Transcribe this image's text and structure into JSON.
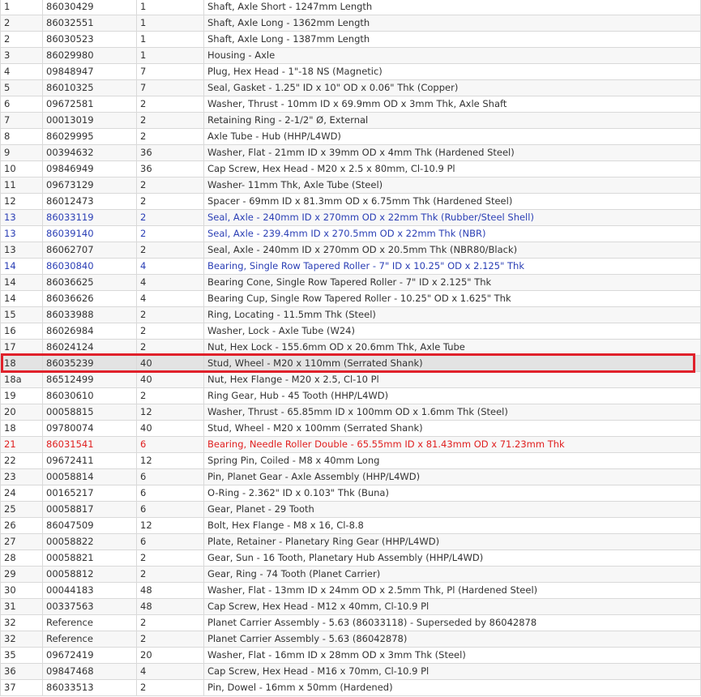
{
  "parts_table": {
    "columns": [
      "ref",
      "part_no",
      "qty",
      "description"
    ],
    "rows": [
      {
        "ref": "1",
        "part_no": "86030429",
        "qty": "1",
        "description": "Shaft, Axle Short - 1247mm Length",
        "style": "normal"
      },
      {
        "ref": "2",
        "part_no": "86032551",
        "qty": "1",
        "description": "Shaft, Axle Long - 1362mm Length",
        "style": "normal"
      },
      {
        "ref": "2",
        "part_no": "86030523",
        "qty": "1",
        "description": "Shaft, Axle Long - 1387mm Length",
        "style": "normal"
      },
      {
        "ref": "3",
        "part_no": "86029980",
        "qty": "1",
        "description": "Housing - Axle",
        "style": "normal"
      },
      {
        "ref": "4",
        "part_no": "09848947",
        "qty": "7",
        "description": "Plug, Hex Head - 1\"-18 NS (Magnetic)",
        "style": "normal"
      },
      {
        "ref": "5",
        "part_no": "86010325",
        "qty": "7",
        "description": "Seal, Gasket - 1.25\" ID x 10\" OD x 0.06\" Thk (Copper)",
        "style": "normal"
      },
      {
        "ref": "6",
        "part_no": "09672581",
        "qty": "2",
        "description": "Washer, Thrust - 10mm ID x 69.9mm OD x 3mm Thk, Axle Shaft",
        "style": "normal"
      },
      {
        "ref": "7",
        "part_no": "00013019",
        "qty": "2",
        "description": "Retaining Ring - 2-1/2\" Ø, External",
        "style": "normal"
      },
      {
        "ref": "8",
        "part_no": "86029995",
        "qty": "2",
        "description": "Axle Tube - Hub (HHP/L4WD)",
        "style": "normal"
      },
      {
        "ref": "9",
        "part_no": "00394632",
        "qty": "36",
        "description": "Washer, Flat - 21mm ID x 39mm OD x 4mm Thk (Hardened Steel)",
        "style": "normal"
      },
      {
        "ref": "10",
        "part_no": "09846949",
        "qty": "36",
        "description": "Cap Screw, Hex Head - M20 x 2.5 x 80mm, Cl-10.9 Pl",
        "style": "normal"
      },
      {
        "ref": "11",
        "part_no": "09673129",
        "qty": "2",
        "description": "Washer- 11mm Thk, Axle Tube (Steel)",
        "style": "normal"
      },
      {
        "ref": "12",
        "part_no": "86012473",
        "qty": "2",
        "description": "Spacer - 69mm ID x 81.3mm OD x 6.75mm Thk (Hardened Steel)",
        "style": "normal"
      },
      {
        "ref": "13",
        "part_no": "86033119",
        "qty": "2",
        "description": "Seal, Axle - 240mm ID x 270mm OD x 22mm Thk (Rubber/Steel Shell)",
        "style": "link"
      },
      {
        "ref": "13",
        "part_no": "86039140",
        "qty": "2",
        "description": "Seal, Axle - 239.4mm ID x 270.5mm OD x 22mm Thk (NBR)",
        "style": "link"
      },
      {
        "ref": "13",
        "part_no": "86062707",
        "qty": "2",
        "description": "Seal, Axle - 240mm ID x 270mm OD x 20.5mm Thk (NBR80/Black)",
        "style": "normal"
      },
      {
        "ref": "14",
        "part_no": "86030840",
        "qty": "4",
        "description": "Bearing, Single Row Tapered Roller - 7\" ID x 10.25\" OD x 2.125\" Thk",
        "style": "link"
      },
      {
        "ref": "14",
        "part_no": "86036625",
        "qty": "4",
        "description": "Bearing Cone, Single Row Tapered Roller - 7\" ID x 2.125\" Thk",
        "style": "normal"
      },
      {
        "ref": "14",
        "part_no": "86036626",
        "qty": "4",
        "description": "Bearing Cup, Single Row Tapered Roller - 10.25\" OD x 1.625\" Thk",
        "style": "normal"
      },
      {
        "ref": "15",
        "part_no": "86033988",
        "qty": "2",
        "description": "Ring, Locating - 11.5mm Thk (Steel)",
        "style": "normal"
      },
      {
        "ref": "16",
        "part_no": "86026984",
        "qty": "2",
        "description": "Washer, Lock - Axle Tube (W24)",
        "style": "normal"
      },
      {
        "ref": "17",
        "part_no": "86024124",
        "qty": "2",
        "description": "Nut, Hex Lock - 155.6mm OD x 20.6mm Thk, Axle Tube",
        "style": "normal"
      },
      {
        "ref": "18",
        "part_no": "86035239",
        "qty": "40",
        "description": "Stud, Wheel - M20 x 110mm (Serrated Shank)",
        "style": "selected"
      },
      {
        "ref": "18a",
        "part_no": "86512499",
        "qty": "40",
        "description": "Nut, Hex Flange - M20 x 2.5, Cl-10 Pl",
        "style": "normal"
      },
      {
        "ref": "19",
        "part_no": "86030610",
        "qty": "2",
        "description": "Ring Gear, Hub - 45 Tooth (HHP/L4WD)",
        "style": "normal"
      },
      {
        "ref": "20",
        "part_no": "00058815",
        "qty": "12",
        "description": "Washer, Thrust - 65.85mm ID x 100mm OD x 1.6mm Thk (Steel)",
        "style": "normal"
      },
      {
        "ref": "18",
        "part_no": "09780074",
        "qty": "40",
        "description": "Stud, Wheel - M20 x 100mm (Serrated Shank)",
        "style": "normal"
      },
      {
        "ref": "21",
        "part_no": "86031541",
        "qty": "6",
        "description": "Bearing, Needle Roller Double - 65.55mm ID x 81.43mm OD x 71.23mm Thk",
        "style": "alert"
      },
      {
        "ref": "22",
        "part_no": "09672411",
        "qty": "12",
        "description": "Spring Pin, Coiled - M8 x 40mm Long",
        "style": "normal"
      },
      {
        "ref": "23",
        "part_no": "00058814",
        "qty": "6",
        "description": "Pin, Planet Gear - Axle Assembly (HHP/L4WD)",
        "style": "normal"
      },
      {
        "ref": "24",
        "part_no": "00165217",
        "qty": "6",
        "description": "O-Ring - 2.362\" ID x 0.103\" Thk (Buna)",
        "style": "normal"
      },
      {
        "ref": "25",
        "part_no": "00058817",
        "qty": "6",
        "description": "Gear, Planet - 29 Tooth",
        "style": "normal"
      },
      {
        "ref": "26",
        "part_no": "86047509",
        "qty": "12",
        "description": "Bolt, Hex Flange - M8 x 16, Cl-8.8",
        "style": "normal"
      },
      {
        "ref": "27",
        "part_no": "00058822",
        "qty": "6",
        "description": "Plate, Retainer - Planetary Ring Gear (HHP/L4WD)",
        "style": "normal"
      },
      {
        "ref": "28",
        "part_no": "00058821",
        "qty": "2",
        "description": "Gear, Sun - 16 Tooth, Planetary Hub Assembly (HHP/L4WD)",
        "style": "normal"
      },
      {
        "ref": "29",
        "part_no": "00058812",
        "qty": "2",
        "description": "Gear, Ring - 74 Tooth (Planet Carrier)",
        "style": "normal"
      },
      {
        "ref": "30",
        "part_no": "00044183",
        "qty": "48",
        "description": "Washer, Flat - 13mm ID x 24mm OD x 2.5mm Thk, Pl (Hardened Steel)",
        "style": "normal"
      },
      {
        "ref": "31",
        "part_no": "00337563",
        "qty": "48",
        "description": "Cap Screw, Hex Head - M12 x 40mm, Cl-10.9 Pl",
        "style": "normal"
      },
      {
        "ref": "32",
        "part_no": "Reference",
        "qty": "2",
        "description": "Planet Carrier Assembly - 5.63 (86033118) - Superseded by 86042878",
        "style": "normal"
      },
      {
        "ref": "32",
        "part_no": "Reference",
        "qty": "2",
        "description": "Planet Carrier Assembly - 5.63 (86042878)",
        "style": "normal"
      },
      {
        "ref": "35",
        "part_no": "09672419",
        "qty": "20",
        "description": "Washer, Flat - 16mm ID x 28mm OD x 3mm Thk (Steel)",
        "style": "normal"
      },
      {
        "ref": "36",
        "part_no": "09847468",
        "qty": "4",
        "description": "Cap Screw, Hex Head - M16 x 70mm, Cl-10.9 Pl",
        "style": "normal"
      },
      {
        "ref": "37",
        "part_no": "86033513",
        "qty": "2",
        "description": "Pin, Dowel - 16mm x 50mm (Hardened)",
        "style": "normal"
      }
    ]
  },
  "colors": {
    "link_text": "#2b3fb5",
    "alert_text": "#e02020",
    "selection_outline": "#e0202a",
    "selected_row_bg": "#e3e3e3",
    "grid_line": "#d9d9d9"
  }
}
